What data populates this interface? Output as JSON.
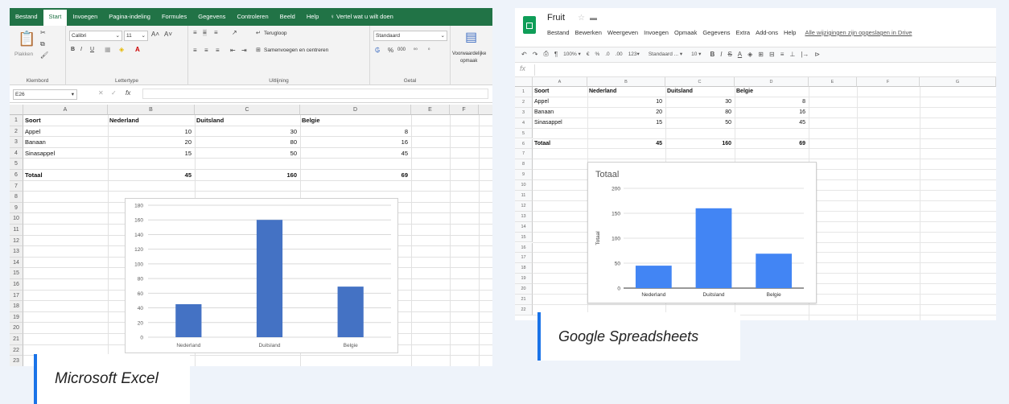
{
  "excel": {
    "tabs": [
      "Bestand",
      "Start",
      "Invoegen",
      "Pagina-indeling",
      "Formules",
      "Gegevens",
      "Controleren",
      "Beeld",
      "Help"
    ],
    "tell_me": "Vertel wat u wilt doen",
    "ribbon": {
      "paste_label": "Plakken",
      "font_name": "Calibri",
      "font_size": "11",
      "wrap_label": "Terugloop",
      "merge_label": "Samenvoegen en centreren",
      "number_format": "Standaard",
      "conditional_label_1": "Voorwaardelijke",
      "conditional_label_2": "opmaak",
      "groups": [
        "Klembord",
        "Lettertype",
        "Uitlijning",
        "Getal"
      ]
    },
    "name_box": "E26",
    "fx_label": "fx",
    "col_headers": [
      "A",
      "B",
      "C",
      "D",
      "E",
      "F",
      "G"
    ],
    "row_headers": [
      "1",
      "2",
      "3",
      "4",
      "5",
      "6",
      "7",
      "8",
      "9",
      "10",
      "11",
      "12",
      "13",
      "14",
      "15",
      "16",
      "17",
      "18",
      "19",
      "20",
      "21",
      "22",
      "23"
    ],
    "table": {
      "header": [
        "Soort",
        "Nederland",
        "Duitsland",
        "Belgie"
      ],
      "rows": [
        [
          "Appel",
          "10",
          "30",
          "8"
        ],
        [
          "Banaan",
          "20",
          "80",
          "16"
        ],
        [
          "Sinasappel",
          "15",
          "50",
          "45"
        ]
      ],
      "total": [
        "Totaal",
        "45",
        "160",
        "69"
      ]
    }
  },
  "google": {
    "doc_title": "Fruit",
    "menu": [
      "Bestand",
      "Bewerken",
      "Weergeven",
      "Invoegen",
      "Opmaak",
      "Gegevens",
      "Extra",
      "Add-ons",
      "Help"
    ],
    "saved_msg": "Alle wijzigingen zijn opgeslagen in Drive",
    "toolbar": {
      "zoom": "100%",
      "currency": "€",
      "percent": "%",
      "decimals_less": ".0",
      "decimals_more": ".00",
      "format_123": "123",
      "font": "Standaard ...",
      "size": "10",
      "bold": "B",
      "italic": "I",
      "strike": "S",
      "text_color": "A"
    },
    "fx_label": "fx",
    "col_headers": [
      "A",
      "B",
      "C",
      "D",
      "E",
      "F",
      "G"
    ],
    "row_headers": [
      "1",
      "2",
      "3",
      "4",
      "5",
      "6",
      "7",
      "8",
      "9",
      "10",
      "11",
      "12",
      "13",
      "14",
      "15",
      "16",
      "17",
      "18",
      "19",
      "20",
      "21",
      "22"
    ],
    "table": {
      "header": [
        "Soort",
        "Nederland",
        "Duitsland",
        "Belgie"
      ],
      "rows": [
        [
          "Appel",
          "10",
          "30",
          "8"
        ],
        [
          "Banaan",
          "20",
          "80",
          "16"
        ],
        [
          "Sinasappel",
          "15",
          "50",
          "45"
        ]
      ],
      "total": [
        "Totaal",
        "45",
        "160",
        "69"
      ]
    }
  },
  "captions": {
    "excel": "Microsoft Excel",
    "google": "Google Spreadsheets"
  },
  "colors": {
    "excel_green": "#217346",
    "excel_bar": "#4472c4",
    "google_bar": "#4285f4",
    "sheets_green": "#0f9d58",
    "accent_blue": "#1a73e8"
  },
  "chart_data": [
    {
      "type": "bar",
      "categories": [
        "Nederland",
        "Duitsland",
        "Belgie"
      ],
      "values": [
        45,
        160,
        69
      ],
      "title": "",
      "xlabel": "",
      "ylabel": "",
      "ylim": [
        0,
        180
      ],
      "yticks": [
        0,
        20,
        40,
        60,
        80,
        100,
        120,
        140,
        160,
        180
      ],
      "grid": true,
      "legend": "none"
    },
    {
      "type": "bar",
      "categories": [
        "Nederland",
        "Duitsland",
        "Belgie"
      ],
      "values": [
        45,
        160,
        69
      ],
      "title": "Totaal",
      "xlabel": "",
      "ylabel": "Totaal",
      "ylim": [
        0,
        200
      ],
      "yticks": [
        0,
        50,
        100,
        150,
        200
      ],
      "grid": true,
      "legend": "none"
    }
  ]
}
